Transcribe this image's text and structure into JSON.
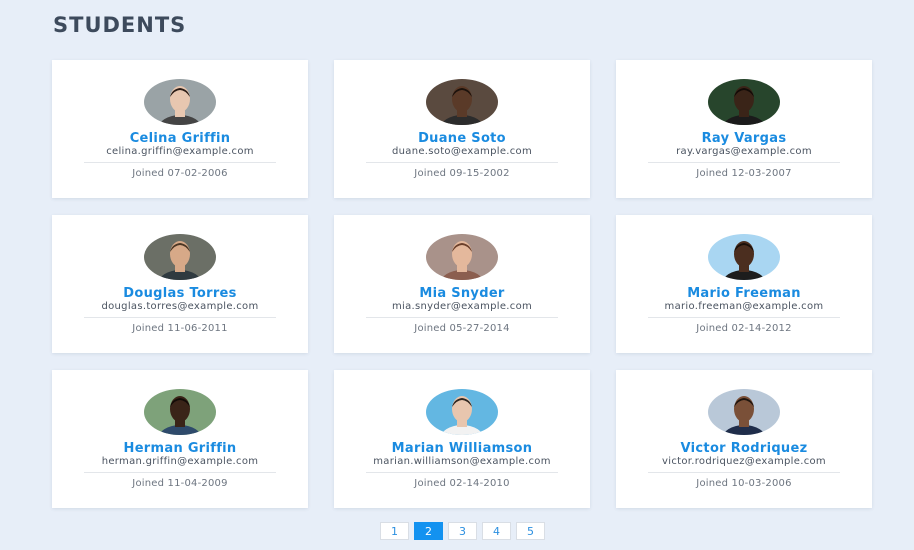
{
  "page": {
    "title": "STUDENTS"
  },
  "students": [
    {
      "name": "Celina Griffin",
      "email": "celina.griffin@example.com",
      "joined": "Joined 07-02-2006",
      "avatar_bg": "#9aa3a6",
      "skin": "#e8c7b0",
      "hair": "#2b1d17",
      "shirt": "#444444"
    },
    {
      "name": "Duane Soto",
      "email": "duane.soto@example.com",
      "joined": "Joined 09-15-2002",
      "avatar_bg": "#5a4a3f",
      "skin": "#5a3a28",
      "hair": "#1c120c",
      "shirt": "#2c2c2c"
    },
    {
      "name": "Ray Vargas",
      "email": "ray.vargas@example.com",
      "joined": "Joined 12-03-2007",
      "avatar_bg": "#27452c",
      "skin": "#3a2418",
      "hair": "#120b07",
      "shirt": "#1b1b1b"
    },
    {
      "name": "Douglas Torres",
      "email": "douglas.torres@example.com",
      "joined": "Joined 11-06-2011",
      "avatar_bg": "#6b6f66",
      "skin": "#d7a988",
      "hair": "#4b3624",
      "shirt": "#2f3a40"
    },
    {
      "name": "Mia Snyder",
      "email": "mia.snyder@example.com",
      "joined": "Joined 05-27-2014",
      "avatar_bg": "#a9928a",
      "skin": "#e4b89c",
      "hair": "#6a3f2a",
      "shirt": "#8b5e4f"
    },
    {
      "name": "Mario Freeman",
      "email": "mario.freeman@example.com",
      "joined": "Joined 02-14-2012",
      "avatar_bg": "#a9d6f2",
      "skin": "#4b2e1f",
      "hair": "#1a100a",
      "shirt": "#1d1d1d"
    },
    {
      "name": "Herman Griffin",
      "email": "herman.griffin@example.com",
      "joined": "Joined 11-04-2009",
      "avatar_bg": "#7ea27a",
      "skin": "#3a2418",
      "hair": "#120b07",
      "shirt": "#2e4a6b"
    },
    {
      "name": "Marian Williamson",
      "email": "marian.williamson@example.com",
      "joined": "Joined 02-14-2010",
      "avatar_bg": "#63b7e2",
      "skin": "#e8c6ae",
      "hair": "#2e2620",
      "shirt": "#f2f2f2"
    },
    {
      "name": "Victor Rodriquez",
      "email": "victor.rodriquez@example.com",
      "joined": "Joined 10-03-2006",
      "avatar_bg": "#b9c8d8",
      "skin": "#7a5038",
      "hair": "#1e140e",
      "shirt": "#1f2d4a"
    }
  ],
  "pagination": {
    "pages": [
      "1",
      "2",
      "3",
      "4",
      "5"
    ],
    "active": "2"
  }
}
